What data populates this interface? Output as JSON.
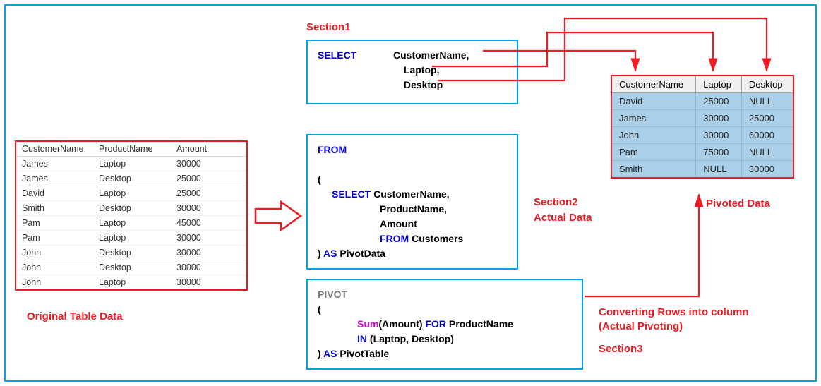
{
  "labels": {
    "section1": "Section1",
    "section2": "Section2",
    "section2_sub": "Actual Data",
    "section3": "Section3",
    "section3_desc1": "Converting Rows into column",
    "section3_desc2": "(Actual Pivoting)",
    "original_table": "Original Table Data",
    "pivoted_data": "Pivoted Data"
  },
  "source_table": {
    "headers": [
      "CustomerName",
      "ProductName",
      "Amount"
    ],
    "rows": [
      [
        "James",
        "Laptop",
        "30000"
      ],
      [
        "James",
        "Desktop",
        "25000"
      ],
      [
        "David",
        "Laptop",
        "25000"
      ],
      [
        "Smith",
        "Desktop",
        "30000"
      ],
      [
        "Pam",
        "Laptop",
        "45000"
      ],
      [
        "Pam",
        "Laptop",
        "30000"
      ],
      [
        "John",
        "Desktop",
        "30000"
      ],
      [
        "John",
        "Desktop",
        "30000"
      ],
      [
        "John",
        "Laptop",
        "30000"
      ]
    ]
  },
  "pivot_table": {
    "headers": [
      "CustomerName",
      "Laptop",
      "Desktop"
    ],
    "rows": [
      [
        "David",
        "25000",
        "NULL"
      ],
      [
        "James",
        "30000",
        "25000"
      ],
      [
        "John",
        "30000",
        "60000"
      ],
      [
        "Pam",
        "75000",
        "NULL"
      ],
      [
        "Smith",
        "NULL",
        "30000"
      ]
    ]
  },
  "sql": {
    "box1": {
      "select": "SELECT",
      "col1": "CustomerName",
      "col2": "Laptop",
      "col3": "Desktop",
      "comma": ","
    },
    "box2": {
      "from": "FROM",
      "open": "(",
      "select": "SELECT",
      "c1": "CustomerName",
      "c2": "ProductName",
      "c3": "Amount",
      "from2": "FROM",
      "tbl": "Customers",
      "close": ")",
      "as": "AS",
      "alias": "PivotData",
      "comma": ","
    },
    "box3": {
      "pivot": "PIVOT",
      "open": "(",
      "sum": "Sum",
      "sumarg_open": "(",
      "sumarg": "Amount",
      "sumarg_close": ")",
      "for": "FOR",
      "forcol": "ProductName",
      "in": "IN",
      "in_open": "(",
      "in1": "Laptop",
      "in_comma": ",",
      "in2": "Desktop",
      "in_close": ")",
      "close": ")",
      "as": "AS",
      "alias": "PivotTable"
    }
  }
}
